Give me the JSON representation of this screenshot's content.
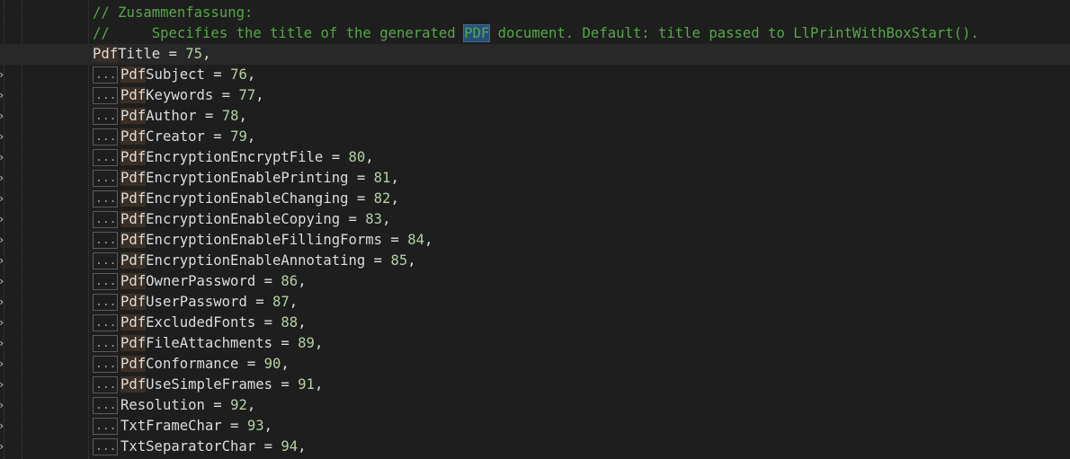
{
  "comment_lines": [
    "// Zusammenfassung:",
    "//     Specifies the title of the generated ",
    "PDF",
    " document. Default: title passed to LlPrintWithBoxStart()."
  ],
  "first_entry": {
    "prefix": "Pdf",
    "rest": "Title",
    "value": "75"
  },
  "entries": [
    {
      "prefix": "Pdf",
      "rest": "Subject",
      "value": "76"
    },
    {
      "prefix": "Pdf",
      "rest": "Keywords",
      "value": "77"
    },
    {
      "prefix": "Pdf",
      "rest": "Author",
      "value": "78"
    },
    {
      "prefix": "Pdf",
      "rest": "Creator",
      "value": "79"
    },
    {
      "prefix": "Pdf",
      "rest": "EncryptionEncryptFile",
      "value": "80"
    },
    {
      "prefix": "Pdf",
      "rest": "EncryptionEnablePrinting",
      "value": "81"
    },
    {
      "prefix": "Pdf",
      "rest": "EncryptionEnableChanging",
      "value": "82"
    },
    {
      "prefix": "Pdf",
      "rest": "EncryptionEnableCopying",
      "value": "83"
    },
    {
      "prefix": "Pdf",
      "rest": "EncryptionEnableFillingForms",
      "value": "84"
    },
    {
      "prefix": "Pdf",
      "rest": "EncryptionEnableAnnotating",
      "value": "85"
    },
    {
      "prefix": "Pdf",
      "rest": "OwnerPassword",
      "value": "86"
    },
    {
      "prefix": "Pdf",
      "rest": "UserPassword",
      "value": "87"
    },
    {
      "prefix": "Pdf",
      "rest": "ExcludedFonts",
      "value": "88"
    },
    {
      "prefix": "Pdf",
      "rest": "FileAttachments",
      "value": "89"
    },
    {
      "prefix": "Pdf",
      "rest": "Conformance",
      "value": "90"
    },
    {
      "prefix": "Pdf",
      "rest": "UseSimpleFrames",
      "value": "91"
    },
    {
      "prefix": "",
      "rest": "Resolution",
      "value": "92"
    },
    {
      "prefix": "",
      "rest": "TxtFrameChar",
      "value": "93"
    },
    {
      "prefix": "",
      "rest": "TxtSeparatorChar",
      "value": "94"
    }
  ],
  "collapsed_marker": "...",
  "fold_glyph": "›",
  "colors": {
    "background": "#1e1e1e",
    "comment": "#57a64a",
    "number": "#b5cea8",
    "identifier": "#dcdcdc",
    "selection": "#264f78"
  }
}
